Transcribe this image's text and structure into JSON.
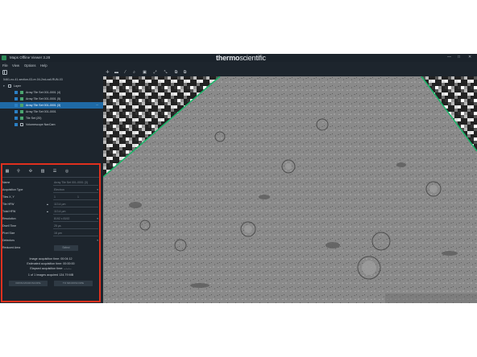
{
  "app": {
    "title": "Maps Offline Viewer 3.28",
    "brand_first": "thermo",
    "brand_second": "scientific",
    "controls": [
      "—",
      "□",
      "✕"
    ]
  },
  "menu": [
    "File",
    "View",
    "Options",
    "Help"
  ],
  "project": {
    "path": "5461-no-41-section-03-re-04-2nd-call-RUN-03"
  },
  "tree": [
    {
      "label": "Layer",
      "level": 0,
      "expanded": true,
      "icon": "layer-icon",
      "checked": false,
      "selected": false
    },
    {
      "label": "Array Tile Set 001-0001 (4)",
      "level": 1,
      "checked": true,
      "icon": "tileset-icon",
      "selected": false
    },
    {
      "label": "Array Tile Set 001-0001 (5)",
      "level": 1,
      "checked": true,
      "icon": "tileset-icon",
      "selected": false
    },
    {
      "label": "Array Tile Set 001-0001 (3)",
      "level": 1,
      "checked": true,
      "icon": "tileset-icon",
      "selected": true,
      "more": "..."
    },
    {
      "label": "Array Tile Set 001-0001",
      "level": 1,
      "checked": true,
      "icon": "tileset-icon",
      "selected": false
    },
    {
      "label": "Tile Set (20)",
      "level": 1,
      "checked": true,
      "icon": "tileset-icon",
      "selected": false
    },
    {
      "label": "Volumescope NavCam",
      "level": 1,
      "checked": true,
      "icon": "camera-icon",
      "selected": false
    }
  ],
  "view_tools": [
    "✛",
    "▬",
    "⁄",
    "⌕",
    "▣",
    "⤢",
    "⤡",
    "⧉",
    "⧉"
  ],
  "properties": {
    "tabs": [
      "grid-icon",
      "pin-icon",
      "crosshair-icon",
      "image-icon",
      "sliders-icon",
      "compass-icon"
    ],
    "rows": [
      {
        "label": "Name",
        "value": "Array Tile Set 001-0001 (3)"
      },
      {
        "label": "Acquisition Type",
        "value": "Electron",
        "caret": true
      },
      {
        "label": "Tiles X, Y",
        "value": "1",
        "value2": "1"
      },
      {
        "label": "Tile HFW",
        "value": "113.4 µm",
        "lock": true
      },
      {
        "label": "Total HFW",
        "value": "113.4 µm",
        "lock": true
      },
      {
        "label": "Resolution",
        "value": "8192 x 8192",
        "caret": true
      },
      {
        "label": "Dwell Time",
        "value": "25 µs"
      },
      {
        "label": "Pixel Size",
        "value": "16 µm"
      },
      {
        "label": "Detectors",
        "value": "",
        "caret": true
      },
      {
        "label": "Reduced Area",
        "value": "",
        "button": "Select"
      }
    ],
    "acquisition": {
      "image_time": "Image acquisition time: 00:04:12",
      "estimated_time": "Estimated acquisition time: 00:00:00",
      "elapsed_time": "Elapsed acquisition time: --:--:--",
      "images_acquired": "1 of 1 images acquired    134.79 MB"
    },
    "buttons": {
      "from_microscope": "FROM MICROSCOPE",
      "to_microscope": "TO MICROSCOPE"
    }
  },
  "colors": {
    "background": "#1d252d",
    "selection": "#1f6aa6",
    "outline_green": "#19b86a",
    "highlight_red": "#e0301e"
  }
}
